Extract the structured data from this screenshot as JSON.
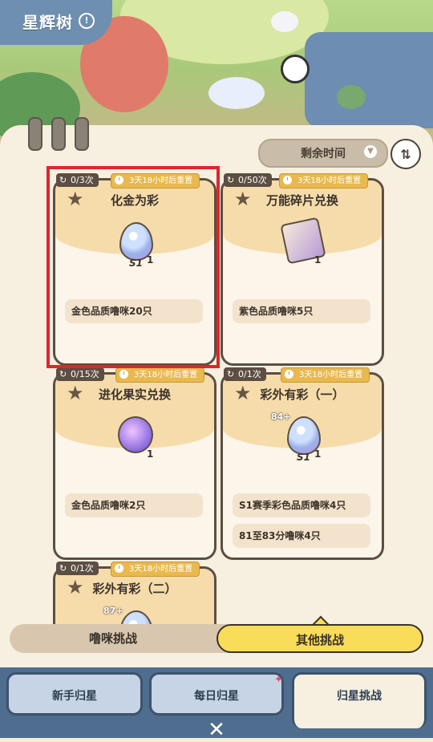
{
  "header": {
    "title": "星辉树"
  },
  "filter": {
    "sort_label": "剩余时间"
  },
  "cards": [
    {
      "counter": "0/3次",
      "timer": "3天18小时后重置",
      "title": "化金为彩",
      "item": "egg",
      "season": "S1",
      "qty": "1",
      "reqs": [
        "金色品质噜咪20只"
      ]
    },
    {
      "counter": "0/50次",
      "timer": "3天18小时后重置",
      "title": "万能碎片兑换",
      "item": "shard",
      "qty": "1",
      "reqs": [
        "紫色品质噜咪5只"
      ]
    },
    {
      "counter": "0/15次",
      "timer": "3天18小时后重置",
      "title": "进化果实兑换",
      "item": "fruit",
      "qty": "1",
      "reqs": [
        "金色品质噜咪2只"
      ]
    },
    {
      "counter": "0/1次",
      "timer": "3天18小时后重置",
      "title": "彩外有彩（一）",
      "item": "egg",
      "level": "84+",
      "season": "S1",
      "qty": "1",
      "reqs": [
        "S1赛季彩色品质噜咪4只",
        "81至83分噜咪4只"
      ]
    },
    {
      "counter": "0/1次",
      "timer": "3天18小时后重置",
      "title": "彩外有彩（二）",
      "item": "egg",
      "level": "87+"
    }
  ],
  "tabs": {
    "left": "噜咪挑战",
    "right": "其他挑战",
    "active": "right"
  },
  "bottom_tabs": [
    {
      "label": "新手归星"
    },
    {
      "label": "每日归星"
    },
    {
      "label": "归星挑战"
    }
  ],
  "colors": {
    "highlight": "#e1242a",
    "active_tab": "#f9dc58",
    "timer": "#e9b94f"
  },
  "icons": [
    "info-icon",
    "chevron-down-icon",
    "swap-icon",
    "refresh-icon",
    "clock-icon",
    "star-icon",
    "close-icon"
  ]
}
